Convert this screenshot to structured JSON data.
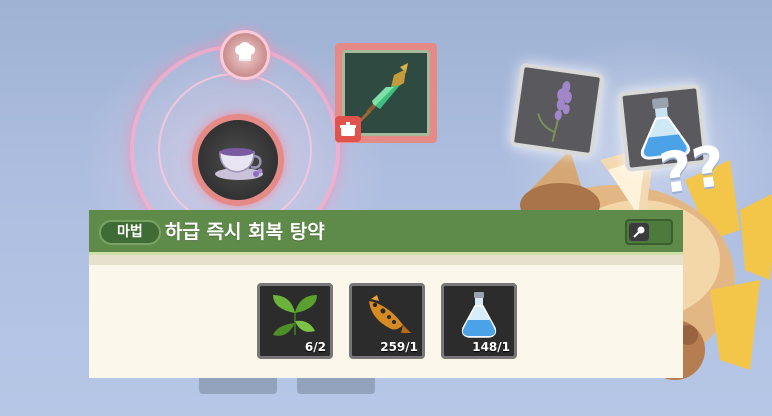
{
  "scene": {
    "background_color": "#a9bbdd",
    "accent_color": "#e58a87",
    "header_color": "#5f8b4a"
  },
  "background": {
    "medal_icon": "chef-hat-icon",
    "center_icon": "teacup-icon",
    "thought_items": [
      "lavender-icon",
      "potion-icon"
    ],
    "question_marks": "??"
  },
  "selected_item": {
    "icon": "spear-tip-icon",
    "badge_icon": "pot-icon"
  },
  "tooltip": {
    "tag": "마법",
    "title": "하급 즉시 회복 탕약",
    "pin_icon": "pin-icon",
    "ingredients": [
      {
        "icon": "herb-leaves-icon",
        "count": "6/2"
      },
      {
        "icon": "fish-icon",
        "count": "259/1"
      },
      {
        "icon": "potion-bottle-icon",
        "count": "148/1"
      }
    ]
  }
}
